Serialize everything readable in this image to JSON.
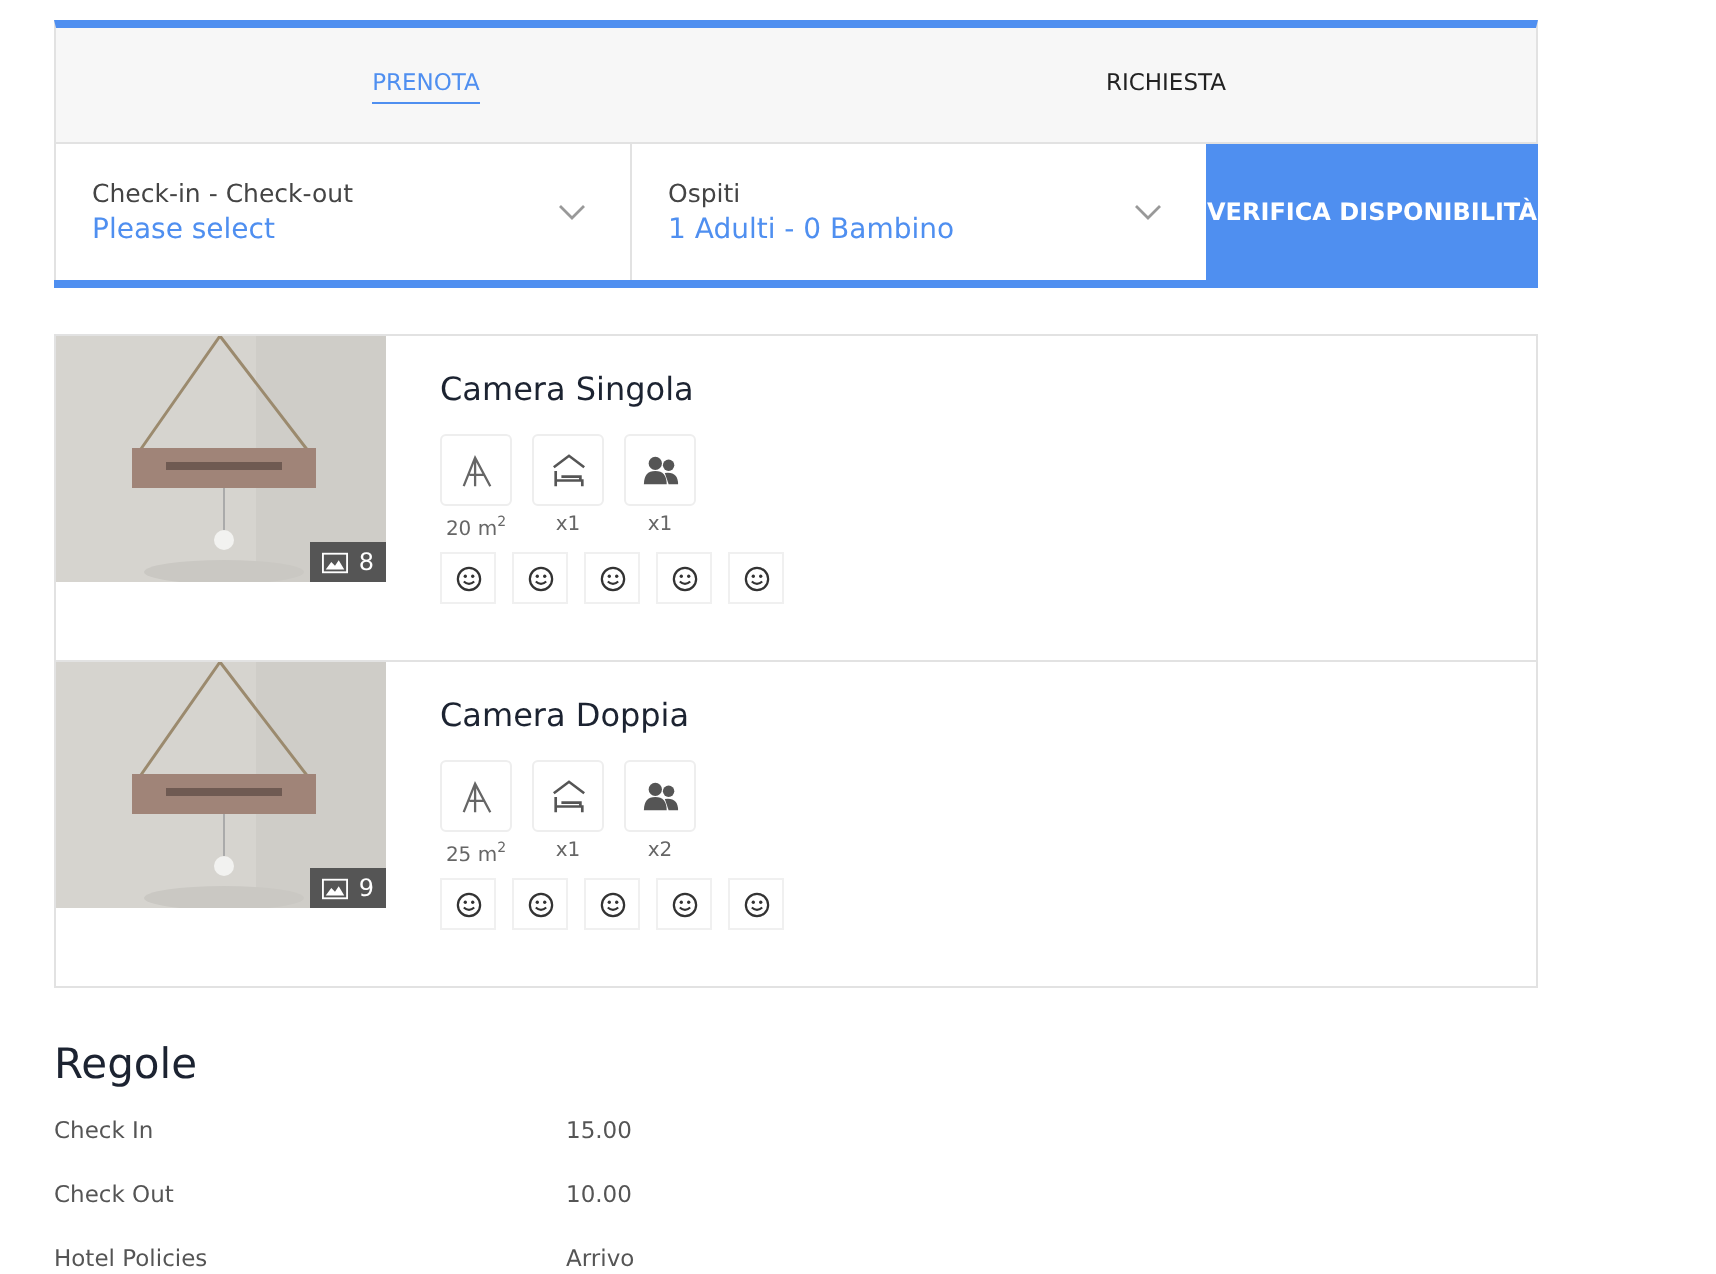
{
  "tabs": [
    {
      "label": "PRENOTA",
      "selected": true
    },
    {
      "label": "RICHIESTA",
      "selected": false
    }
  ],
  "search": {
    "dates": {
      "label": "Check-in - Check-out",
      "value": "Please select"
    },
    "guests": {
      "label": "Ospiti",
      "value": "1 Adulti - 0 Bambino"
    },
    "button": "VERIFICA DISPONIBILITÀ"
  },
  "rooms": [
    {
      "name": "Camera Singola",
      "photo_count": "8",
      "area": "20 m$^{2}$",
      "beds": "x1",
      "guests": "x1",
      "amenities": [
        {
          "kind": "smiley"
        },
        {
          "kind": "smiley"
        },
        {
          "kind": "smiley"
        },
        {
          "kind": "smiley"
        },
        {
          "kind": "smiley"
        }
      ]
    },
    {
      "name": "Camera Doppia",
      "photo_count": "9",
      "area": "25 m$^{2}$",
      "beds": "x1",
      "guests": "x2",
      "amenities": [
        {
          "kind": "smiley"
        },
        {
          "kind": "smiley"
        },
        {
          "kind": "smiley"
        },
        {
          "kind": "smiley"
        },
        {
          "kind": "smiley"
        }
      ]
    }
  ],
  "rules": {
    "title": "Regole",
    "rows": [
      {
        "label": "Check In",
        "value": "15.00"
      },
      {
        "label": "Check Out",
        "value": "10.00"
      },
      {
        "label": "Hotel Policies",
        "value": "Arrivo"
      }
    ]
  }
}
